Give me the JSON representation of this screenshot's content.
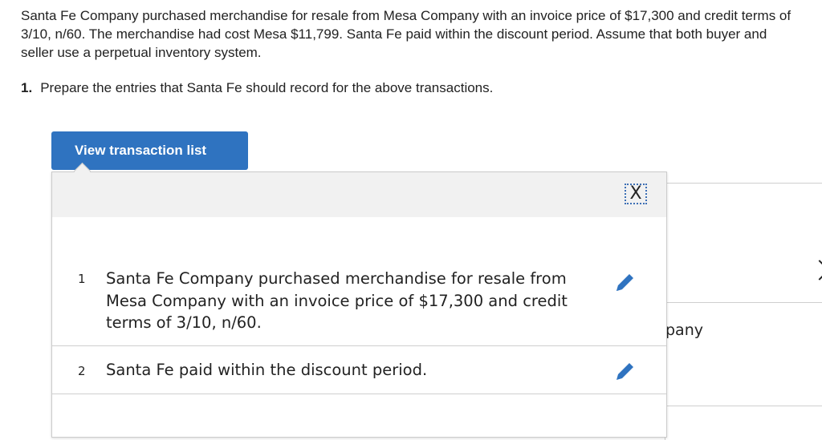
{
  "problem": {
    "text": "Santa Fe Company purchased merchandise for resale from Mesa Company with an invoice price of $17,300 and credit terms of 3/10, n/60. The merchandise had cost Mesa $11,799. Santa Fe paid within the discount period. Assume that both buyer and seller use a perpetual inventory system.",
    "question_number": "1.",
    "question_text": "Prepare the entries that Santa Fe should record for the above transactions."
  },
  "popup": {
    "button_label": "View transaction list",
    "close_symbol": "X",
    "transactions": [
      {
        "num": "1",
        "text": "Santa Fe Company purchased merchandise for resale from Mesa Company with an invoice price of $17,300 and credit terms of 3/10, n/60."
      },
      {
        "num": "2",
        "text": "Santa Fe paid within the discount period."
      }
    ],
    "edit_icon": "pencil-icon"
  },
  "background": {
    "partial_text": "pany"
  },
  "colors": {
    "accent": "#2f73c0",
    "header_bg": "#f1f1f1"
  }
}
